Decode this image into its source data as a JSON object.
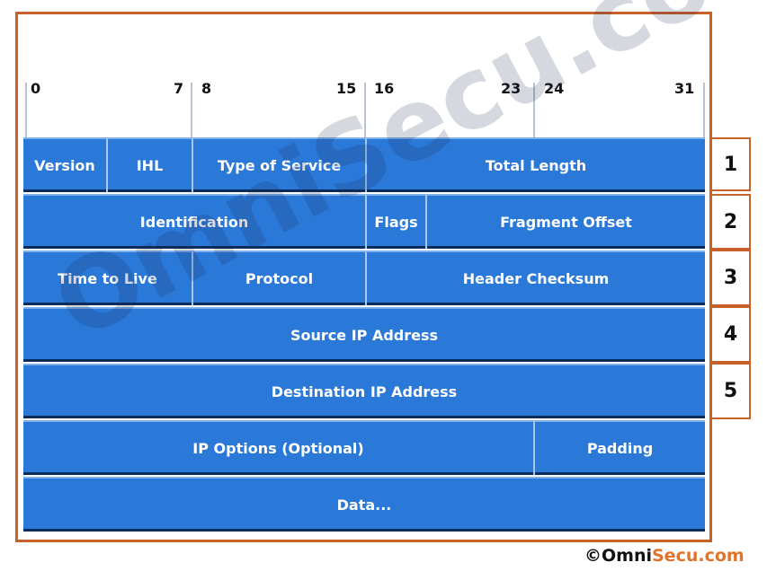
{
  "bits": [
    "0",
    "7",
    "8",
    "15",
    "16",
    "23",
    "24",
    "31"
  ],
  "rows": [
    {
      "number": "1",
      "fields": [
        "Version",
        "IHL",
        "Type of Service",
        "Total Length"
      ]
    },
    {
      "number": "2",
      "fields": [
        "Identification",
        "Flags",
        "Fragment Offset"
      ]
    },
    {
      "number": "3",
      "fields": [
        "Time to Live",
        "Protocol",
        "Header Checksum"
      ]
    },
    {
      "number": "4",
      "fields": [
        "Source IP Address"
      ]
    },
    {
      "number": "5",
      "fields": [
        "Destination IP Address"
      ]
    },
    {
      "fields": [
        "IP Options (Optional)",
        "Padding"
      ]
    },
    {
      "fields": [
        "Data..."
      ]
    }
  ],
  "watermark": "OmniSecu.com",
  "copyright": {
    "symbol": "©",
    "part1": "Omni",
    "part2": "Secu.com"
  },
  "colors": {
    "field": "#2a78d8",
    "frame": "#c8602a",
    "brand_accent": "#e0742c"
  }
}
